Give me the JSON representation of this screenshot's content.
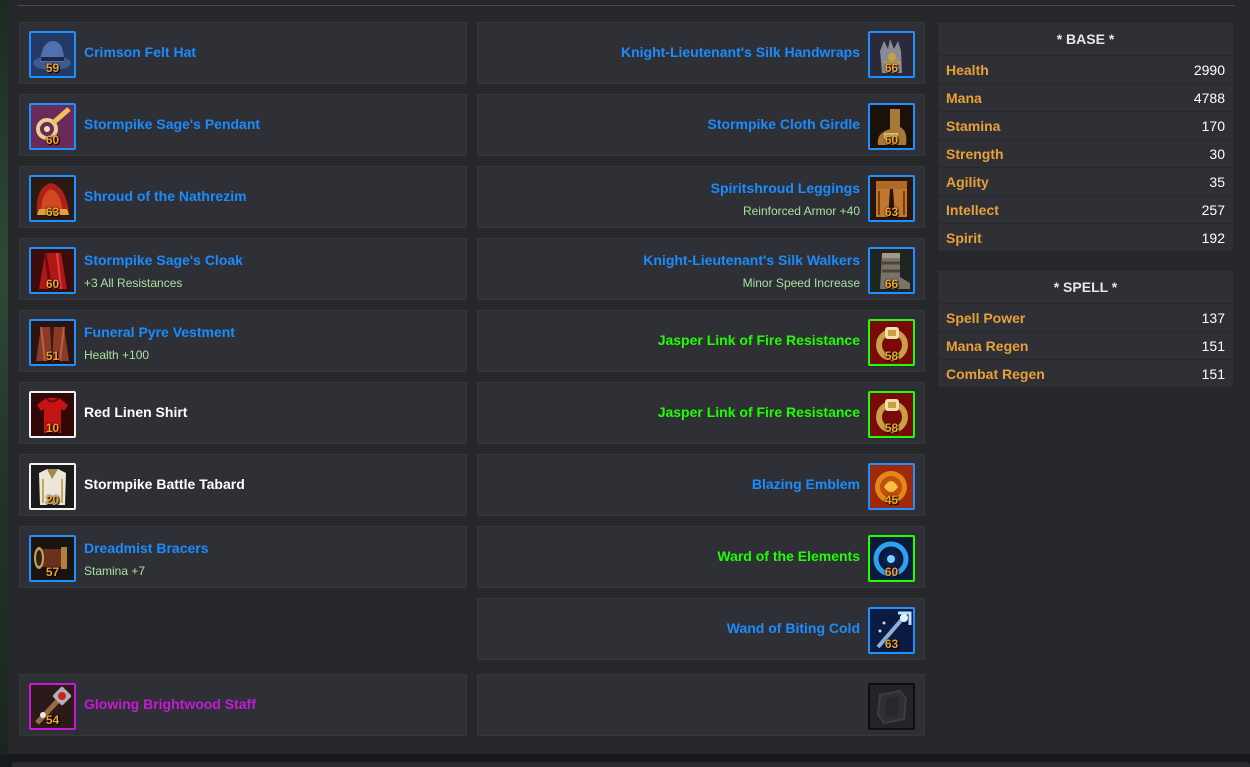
{
  "left_slots": [
    {
      "name": "Crimson Felt Hat",
      "sub": "",
      "ilvl": "59",
      "quality": "blue",
      "icon": "hat-icon"
    },
    {
      "name": "Stormpike Sage's Pendant",
      "sub": "",
      "ilvl": "60",
      "quality": "blue",
      "icon": "pendant-icon"
    },
    {
      "name": "Shroud of the Nathrezim",
      "sub": "",
      "ilvl": "63",
      "quality": "blue",
      "icon": "shoulder-icon"
    },
    {
      "name": "Stormpike Sage's Cloak",
      "sub": "+3 All Resistances",
      "ilvl": "60",
      "quality": "blue",
      "icon": "cloak-icon"
    },
    {
      "name": "Funeral Pyre Vestment",
      "sub": "Health +100",
      "ilvl": "51",
      "quality": "blue",
      "icon": "robe-icon"
    },
    {
      "name": "Red Linen Shirt",
      "sub": "",
      "ilvl": "10",
      "quality": "white",
      "icon": "shirt-icon"
    },
    {
      "name": "Stormpike Battle Tabard",
      "sub": "",
      "ilvl": "20",
      "quality": "white",
      "icon": "tabard-icon"
    },
    {
      "name": "Dreadmist Bracers",
      "sub": "Stamina +7",
      "ilvl": "57",
      "quality": "blue",
      "icon": "bracers-icon"
    }
  ],
  "right_slots": [
    {
      "name": "Knight-Lieutenant's Silk Handwraps",
      "sub": "",
      "ilvl": "66",
      "quality": "blue",
      "icon": "gloves-icon"
    },
    {
      "name": "Stormpike Cloth Girdle",
      "sub": "",
      "ilvl": "60",
      "quality": "blue",
      "icon": "belt-icon"
    },
    {
      "name": "Spiritshroud Leggings",
      "sub": "Reinforced Armor +40",
      "ilvl": "63",
      "quality": "blue",
      "icon": "leggings-icon"
    },
    {
      "name": "Knight-Lieutenant's Silk Walkers",
      "sub": "Minor Speed Increase",
      "ilvl": "66",
      "quality": "blue",
      "icon": "boots-icon"
    },
    {
      "name": "Jasper Link of Fire Resistance",
      "sub": "",
      "ilvl": "58",
      "quality": "green",
      "icon": "ring-icon"
    },
    {
      "name": "Jasper Link of Fire Resistance",
      "sub": "",
      "ilvl": "58",
      "quality": "green",
      "icon": "ring-icon"
    },
    {
      "name": "Blazing Emblem",
      "sub": "",
      "ilvl": "45",
      "quality": "blue",
      "icon": "emblem-trinket-icon"
    },
    {
      "name": "Ward of the Elements",
      "sub": "",
      "ilvl": "60",
      "quality": "green",
      "icon": "ward-trinket-icon"
    },
    {
      "name": "Wand of Biting Cold",
      "sub": "",
      "ilvl": "63",
      "quality": "blue",
      "icon": "wand-icon"
    }
  ],
  "weapon_slots": {
    "main_hand": {
      "name": "Glowing Brightwood Staff",
      "ilvl": "54",
      "quality": "purple",
      "icon": "staff-icon"
    },
    "off_hand": {
      "icon": "empty-shield-slot-icon"
    }
  },
  "stats": {
    "base": {
      "title": "* BASE *",
      "rows": [
        {
          "label": "Health",
          "value": "2990"
        },
        {
          "label": "Mana",
          "value": "4788"
        },
        {
          "label": "Stamina",
          "value": "170"
        },
        {
          "label": "Strength",
          "value": "30"
        },
        {
          "label": "Agility",
          "value": "35"
        },
        {
          "label": "Intellect",
          "value": "257"
        },
        {
          "label": "Spirit",
          "value": "192"
        }
      ]
    },
    "spell": {
      "title": "* SPELL *",
      "rows": [
        {
          "label": "Spell Power",
          "value": "137"
        },
        {
          "label": "Mana Regen",
          "value": "151"
        },
        {
          "label": "Combat Regen",
          "value": "151"
        }
      ]
    }
  },
  "colors": {
    "blue": "#1a8cff",
    "white": "#ffffff",
    "green": "#1eff00",
    "purple": "#c61ad6",
    "stat_label": "#e8a038",
    "ilvl": "#f0a030"
  }
}
